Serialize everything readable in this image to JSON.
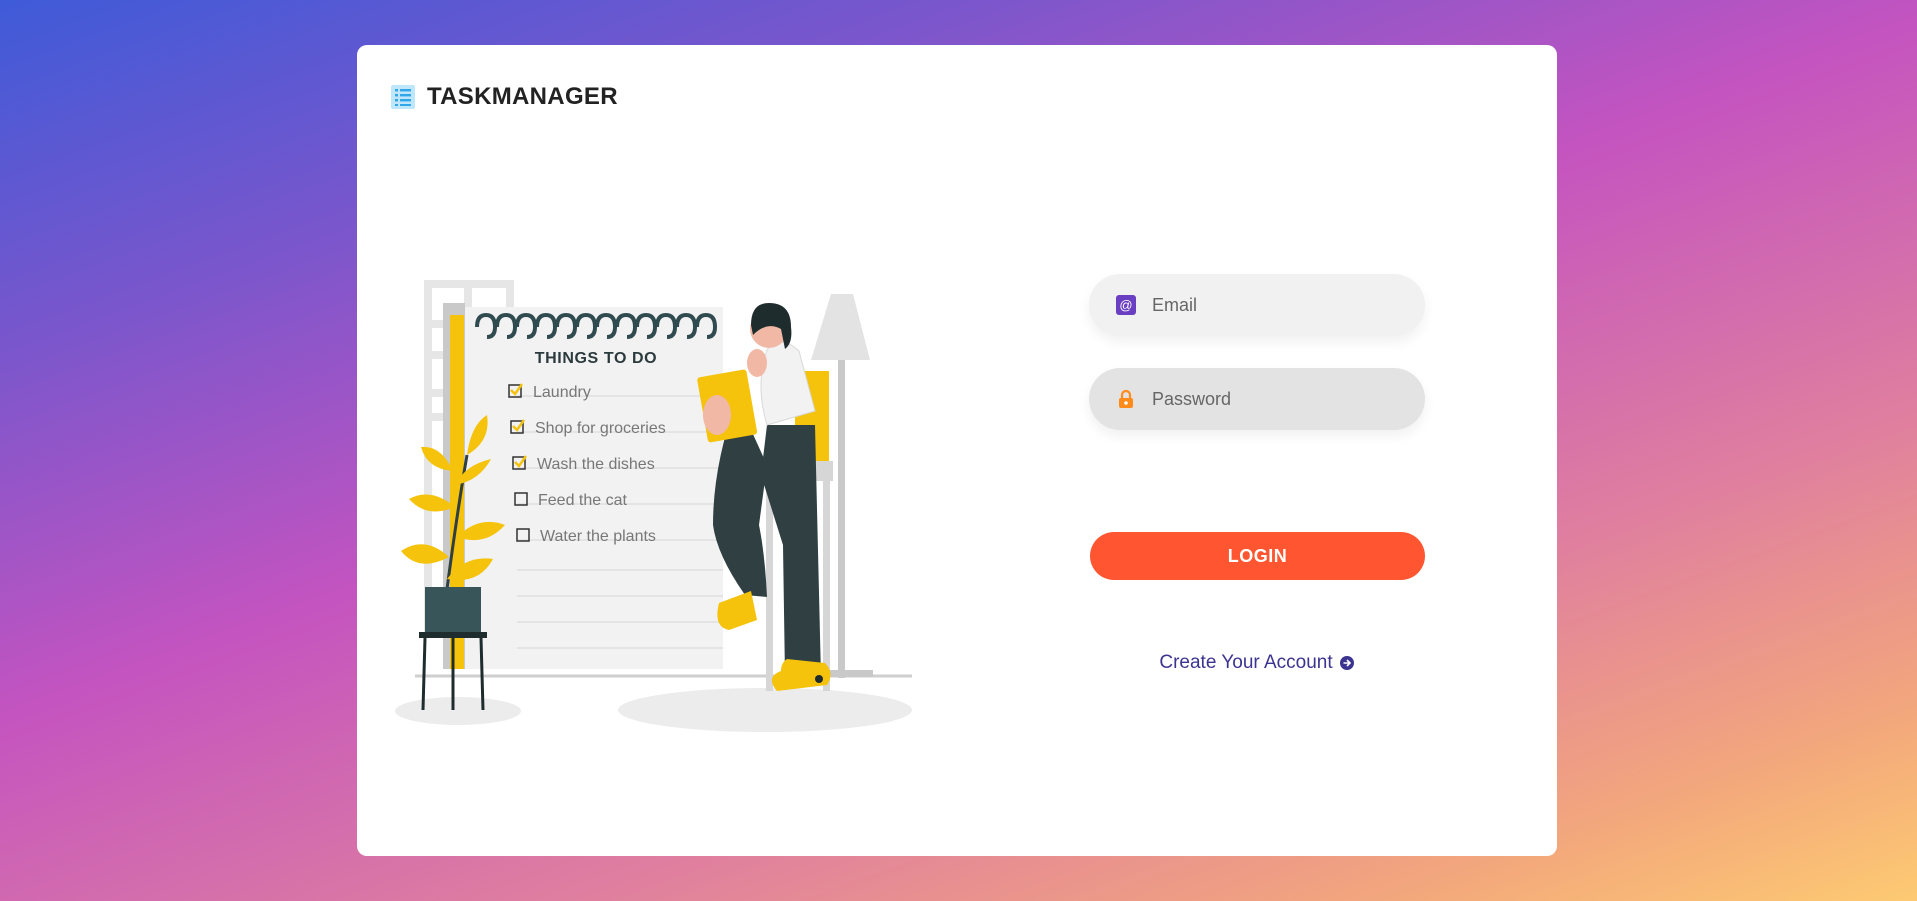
{
  "app": {
    "name": "TASKMANAGER",
    "icon": "list-icon"
  },
  "illustration": {
    "heading": "THINGS TO DO",
    "items": [
      {
        "label": "Laundry",
        "checked": true
      },
      {
        "label": "Shop for groceries",
        "checked": true
      },
      {
        "label": "Wash the dishes",
        "checked": true
      },
      {
        "label": "Feed the cat",
        "checked": false
      },
      {
        "label": "Water the plants",
        "checked": false
      }
    ]
  },
  "form": {
    "email": {
      "placeholder": "Email",
      "value": "",
      "icon": "at-icon"
    },
    "password": {
      "placeholder": "Password",
      "value": "",
      "icon": "lock-icon"
    },
    "login_label": "LOGIN",
    "create_account_label": "Create Your Account",
    "create_account_icon": "arrow-right-circle-icon"
  },
  "colors": {
    "accent": "#ff5530",
    "link": "#3b3490",
    "brand_icon": "#2fa7e8",
    "email_icon": "#6a3fc1",
    "lock_icon": "#ff8c1a"
  }
}
